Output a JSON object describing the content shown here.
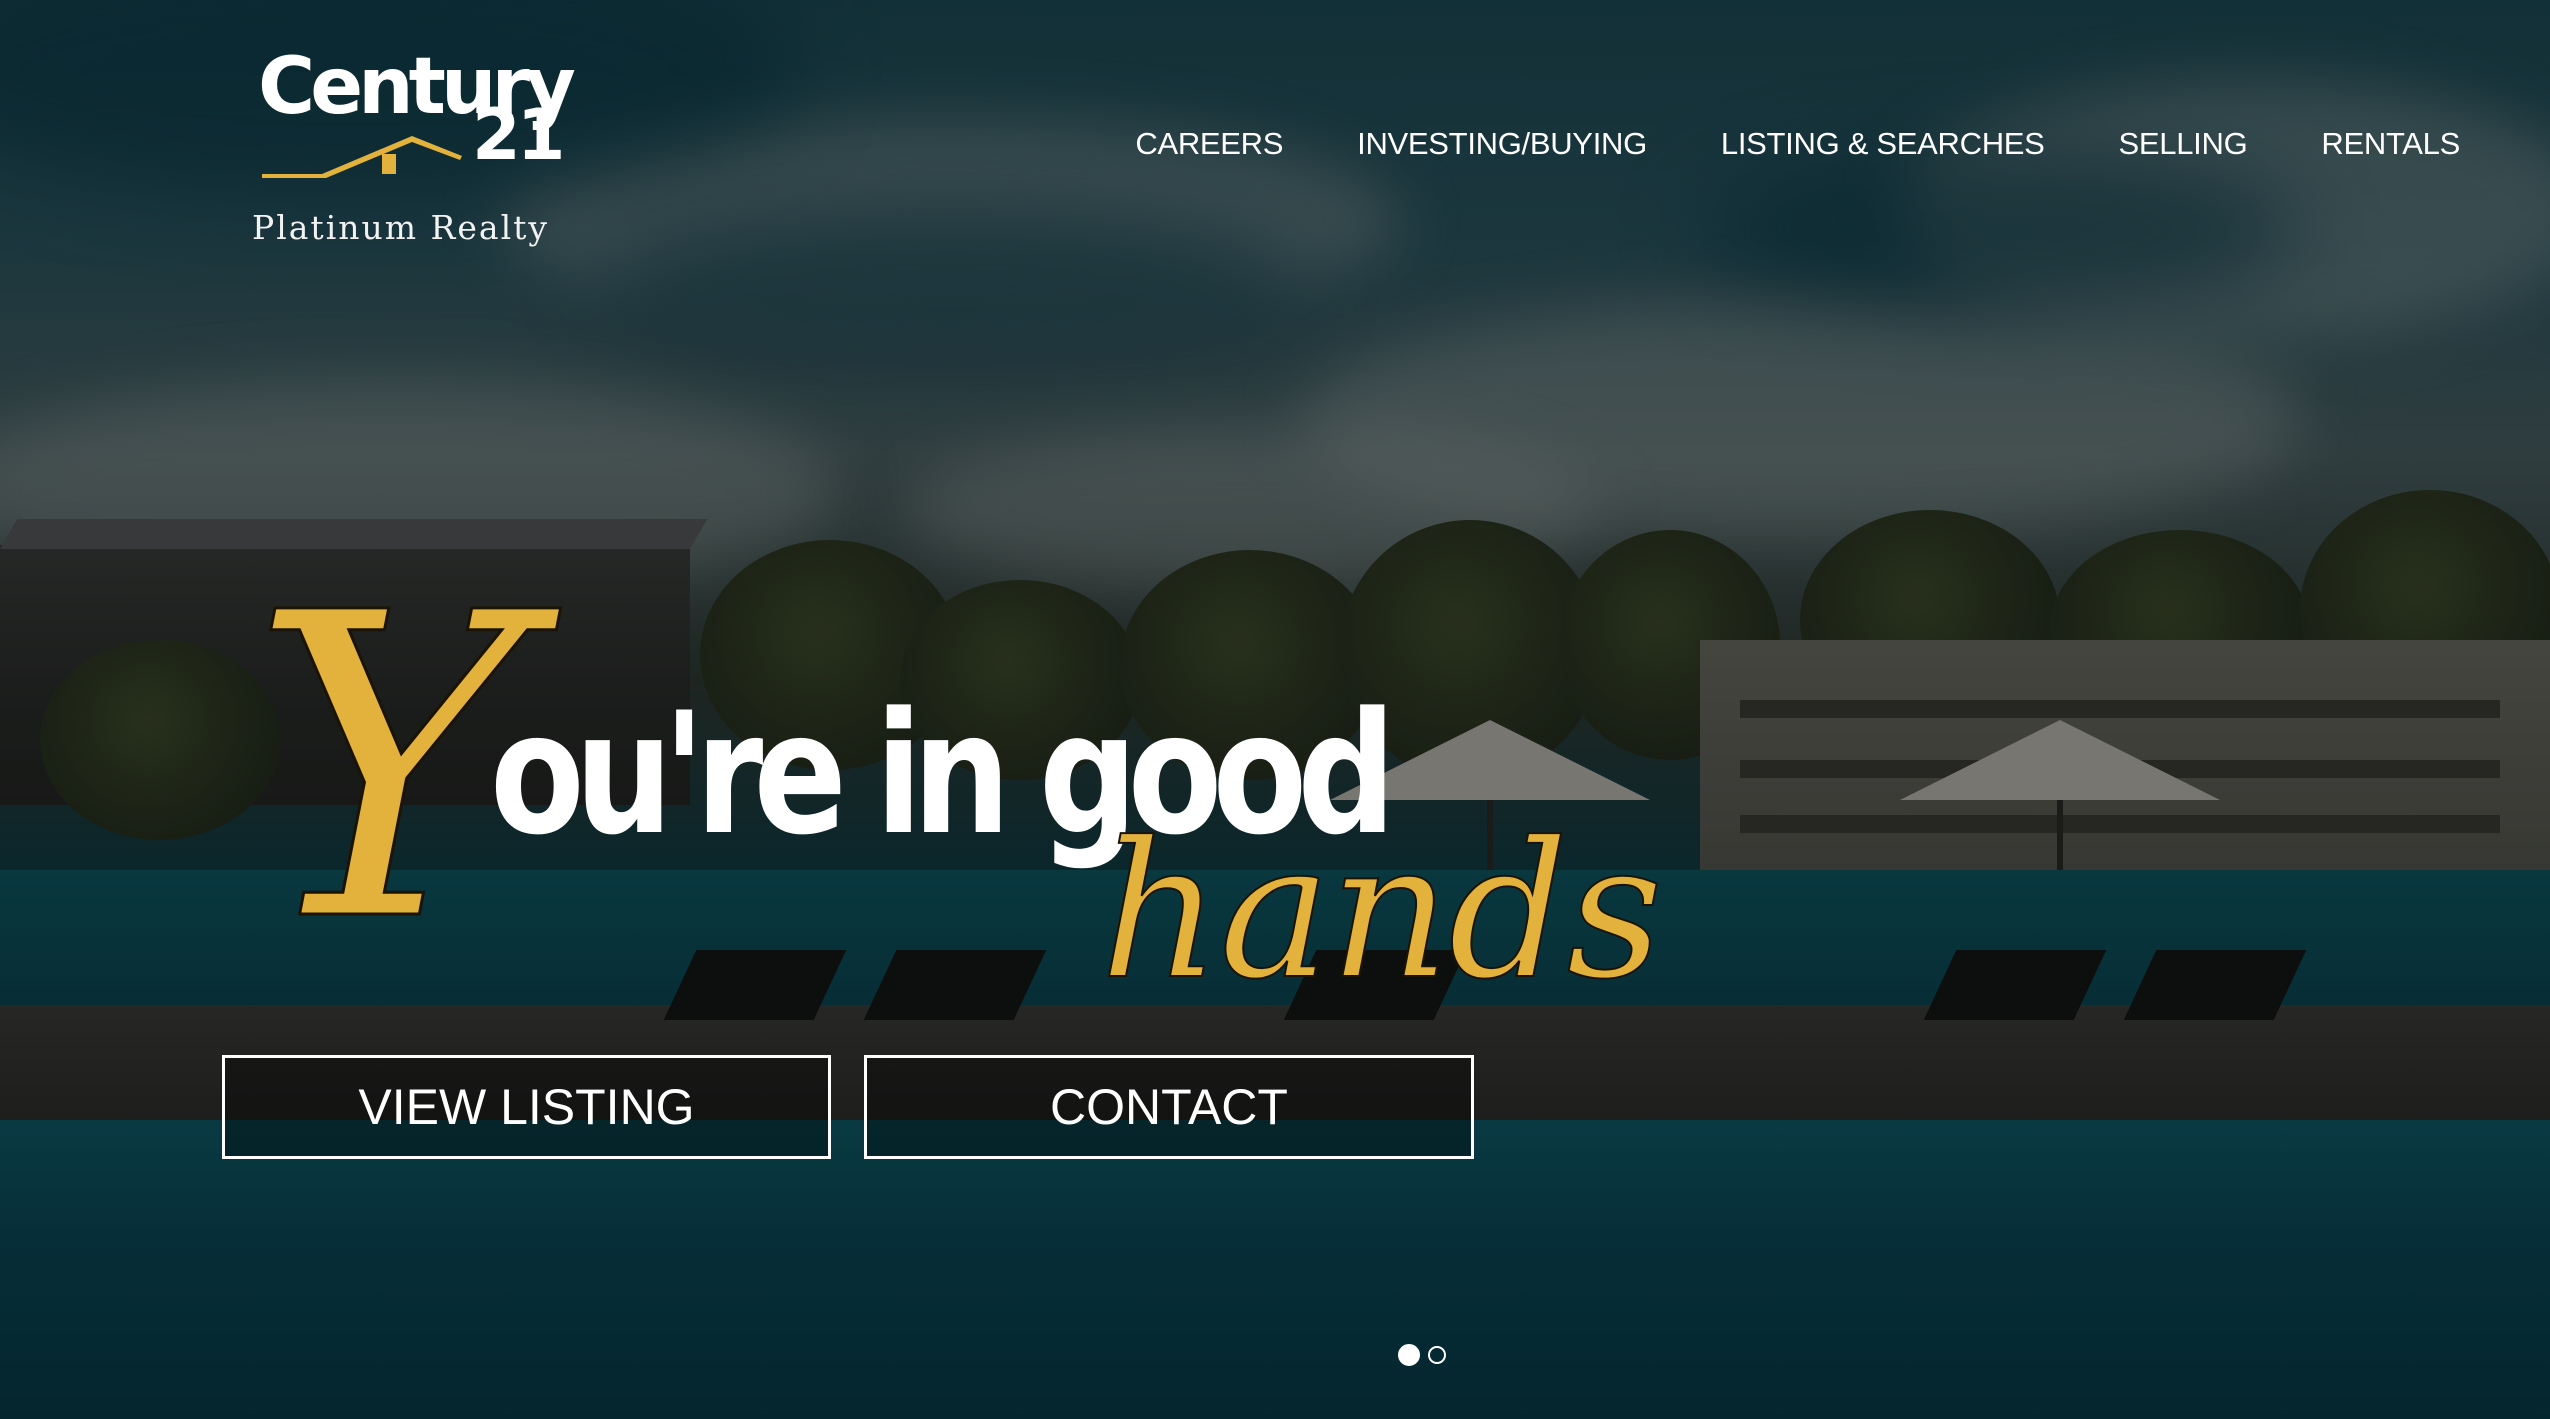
{
  "brand": {
    "name_part1": "Century",
    "name_part2": "21",
    "tagline": "Platinum Realty",
    "accent_color": "#e3b23c"
  },
  "nav": {
    "items": [
      {
        "label": "CAREERS"
      },
      {
        "label": "INVESTING/BUYING"
      },
      {
        "label": "LISTING & SEARCHES"
      },
      {
        "label": "SELLING"
      },
      {
        "label": "RENTALS"
      }
    ]
  },
  "hero": {
    "headline_initial": "Y",
    "headline_main": "ou're in good",
    "headline_script": "hands",
    "buttons": {
      "view_listing": "VIEW LISTING",
      "contact": "CONTACT"
    },
    "slider": {
      "total_slides": 2,
      "active_slide": 1
    }
  }
}
